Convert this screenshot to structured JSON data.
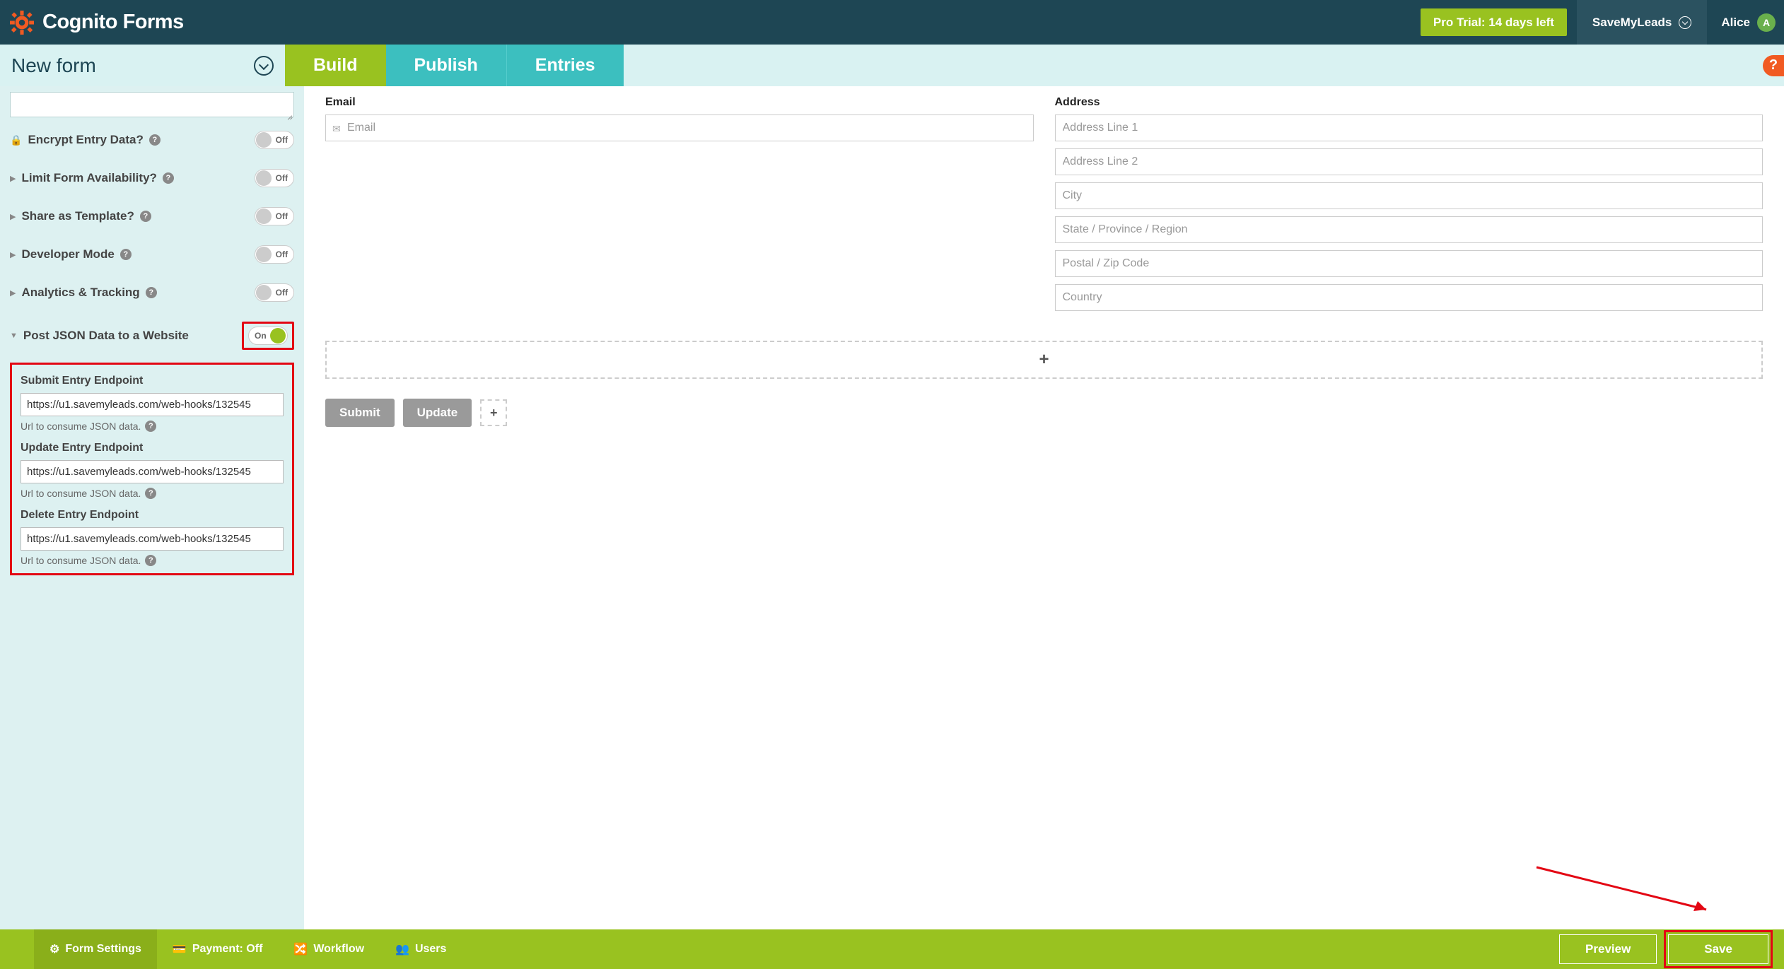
{
  "header": {
    "logo_text": "Cognito Forms",
    "trial_label": "Pro Trial: 14 days left",
    "org_name": "SaveMyLeads",
    "user_name": "Alice",
    "user_initial": "A"
  },
  "subheader": {
    "form_name": "New form",
    "tabs": {
      "build": "Build",
      "publish": "Publish",
      "entries": "Entries"
    },
    "help": "?"
  },
  "sidebar": {
    "settings": [
      {
        "icon": "lock",
        "label": "Encrypt Entry Data?",
        "state": "Off"
      },
      {
        "icon": "tri",
        "label": "Limit Form Availability?",
        "state": "Off"
      },
      {
        "icon": "tri",
        "label": "Share as Template?",
        "state": "Off"
      },
      {
        "icon": "tri",
        "label": "Developer Mode",
        "state": "Off"
      },
      {
        "icon": "tri",
        "label": "Analytics & Tracking",
        "state": "Off"
      }
    ],
    "post_json": {
      "label": "Post JSON Data to a Website",
      "state": "On",
      "endpoints": [
        {
          "title": "Submit Entry Endpoint",
          "value": "https://u1.savemyleads.com/web-hooks/132545",
          "help": "Url to consume JSON data."
        },
        {
          "title": "Update Entry Endpoint",
          "value": "https://u1.savemyleads.com/web-hooks/132545",
          "help": "Url to consume JSON data."
        },
        {
          "title": "Delete Entry Endpoint",
          "value": "https://u1.savemyleads.com/web-hooks/132545",
          "help": "Url to consume JSON data."
        }
      ]
    }
  },
  "canvas": {
    "email_label": "Email",
    "email_placeholder": "Email",
    "address_label": "Address",
    "address_placeholders": [
      "Address Line 1",
      "Address Line 2",
      "City",
      "State / Province / Region",
      "Postal / Zip Code",
      "Country"
    ],
    "add_zone": "+",
    "actions": {
      "submit": "Submit",
      "update": "Update",
      "add": "+"
    }
  },
  "footer": {
    "form_settings": "Form Settings",
    "payment": "Payment: Off",
    "workflow": "Workflow",
    "users": "Users",
    "preview": "Preview",
    "save": "Save"
  }
}
